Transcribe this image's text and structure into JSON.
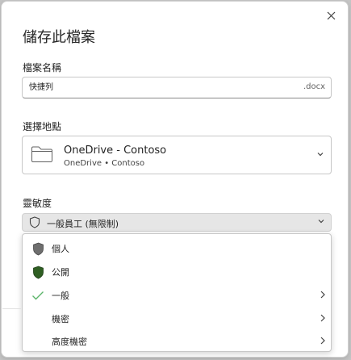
{
  "dialog": {
    "title": "儲存此檔案",
    "close_label": "×"
  },
  "filename": {
    "label": "檔案名稱",
    "value": "快捷列",
    "extension": ".docx"
  },
  "location": {
    "label": "選擇地點",
    "primary": "OneDrive - Contoso",
    "secondary": "OneDrive • Contoso",
    "icon": "folder-icon"
  },
  "sensitivity": {
    "label": "靈敏度",
    "selected": "一般員工 (無限制)",
    "icon": "shield-icon",
    "options": [
      {
        "label": "個人",
        "icon": "shield-gray-icon",
        "has_submenu": false
      },
      {
        "label": "公開",
        "icon": "shield-green-icon",
        "has_submenu": false
      },
      {
        "label": "一般",
        "icon": "checkmark-icon",
        "has_submenu": true
      },
      {
        "label": "機密",
        "icon": "",
        "has_submenu": true
      },
      {
        "label": "高度機密",
        "icon": "",
        "has_submenu": true
      }
    ]
  },
  "colors": {
    "checkmark": "#5bb56a",
    "shield_gray": "#6e6e6e",
    "shield_green": "#2f5f23",
    "selected_bg": "#e6e6e6"
  }
}
